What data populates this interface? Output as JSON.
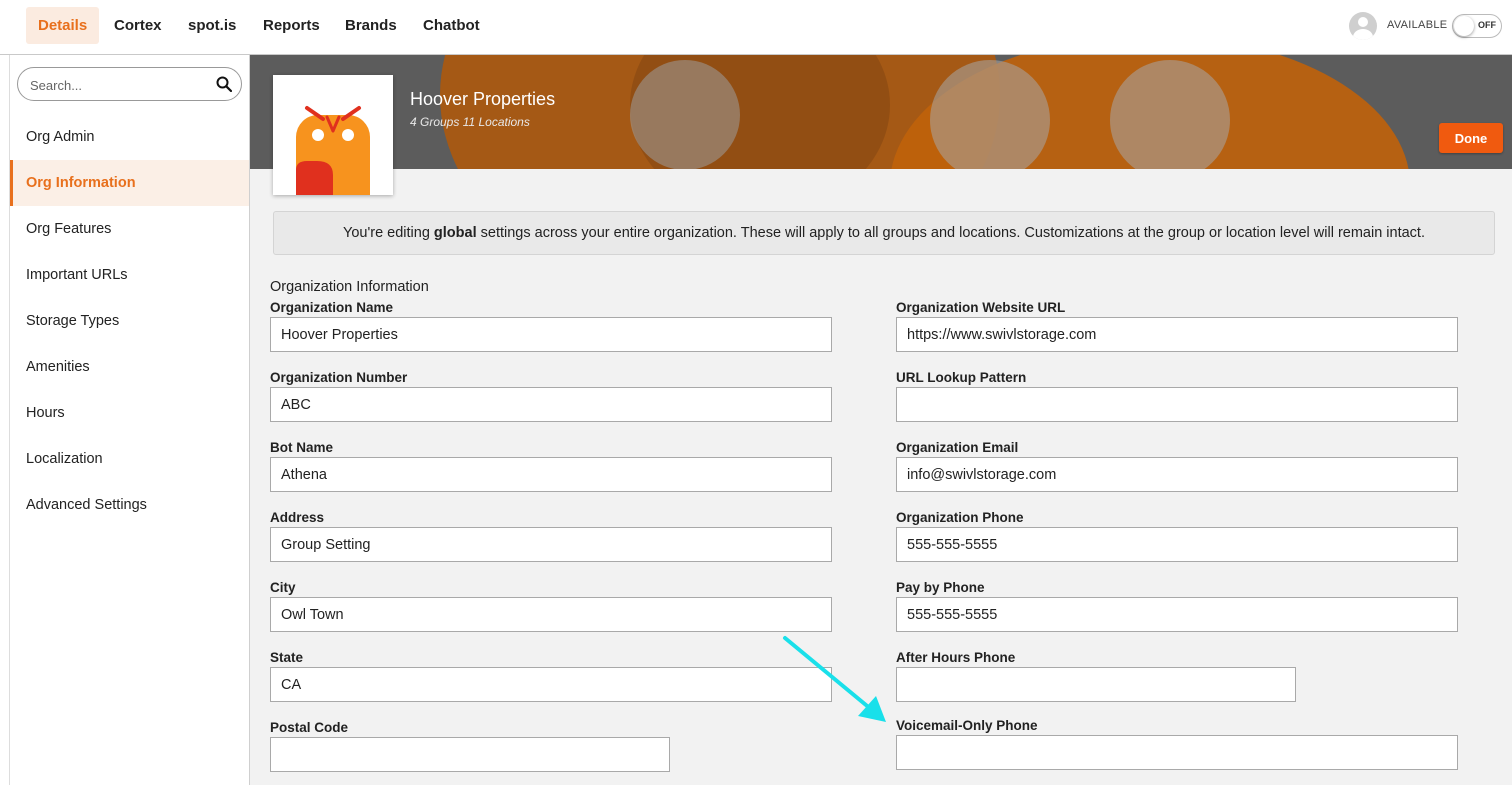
{
  "nav": {
    "tabs": [
      {
        "label": "Details",
        "active": true
      },
      {
        "label": "Cortex"
      },
      {
        "label": "spot.is"
      },
      {
        "label": "Reports"
      },
      {
        "label": "Brands"
      },
      {
        "label": "Chatbot"
      }
    ],
    "status_label": "AVAILABLE",
    "toggle_label": "OFF"
  },
  "sidebar": {
    "search_placeholder": "Search...",
    "items": [
      {
        "label": "Org Admin"
      },
      {
        "label": "Org Information",
        "active": true
      },
      {
        "label": "Org Features"
      },
      {
        "label": "Important URLs"
      },
      {
        "label": "Storage Types"
      },
      {
        "label": "Amenities"
      },
      {
        "label": "Hours"
      },
      {
        "label": "Localization"
      },
      {
        "label": "Advanced Settings"
      }
    ]
  },
  "header": {
    "org_name": "Hoover Properties",
    "org_meta": "4 Groups 11 Locations",
    "done_label": "Done"
  },
  "notice": {
    "prefix": "You're editing ",
    "emphasis": "global",
    "suffix": " settings across your entire organization. These will apply to all groups and locations. Customizations at the group or location level will remain intact."
  },
  "form": {
    "section_title": "Organization Information",
    "left": [
      {
        "label": "Organization Name",
        "value": "Hoover Properties"
      },
      {
        "label": "Organization Number",
        "value": "ABC"
      },
      {
        "label": "Bot Name",
        "value": "Athena"
      },
      {
        "label": "Address",
        "value": "Group Setting"
      },
      {
        "label": "City",
        "value": "Owl Town"
      },
      {
        "label": "State",
        "value": "CA"
      },
      {
        "label": "Postal Code",
        "value": ""
      }
    ],
    "right": [
      {
        "label": "Organization Website URL",
        "value": "https://www.swivlstorage.com"
      },
      {
        "label": "URL Lookup Pattern",
        "value": ""
      },
      {
        "label": "Organization Email",
        "value": "info@swivlstorage.com"
      },
      {
        "label": "Organization Phone",
        "value": "555-555-5555"
      },
      {
        "label": "Pay by Phone",
        "value": "555-555-5555"
      },
      {
        "label": "After Hours Phone",
        "value": ""
      },
      {
        "label": "Voicemail-Only Phone",
        "value": ""
      }
    ]
  },
  "colors": {
    "accent": "#e8701d",
    "done_button": "#f05a0f",
    "annotation_arrow": "#19e0ea",
    "logo_orange": "#f7931e",
    "logo_red": "#e0301e"
  }
}
